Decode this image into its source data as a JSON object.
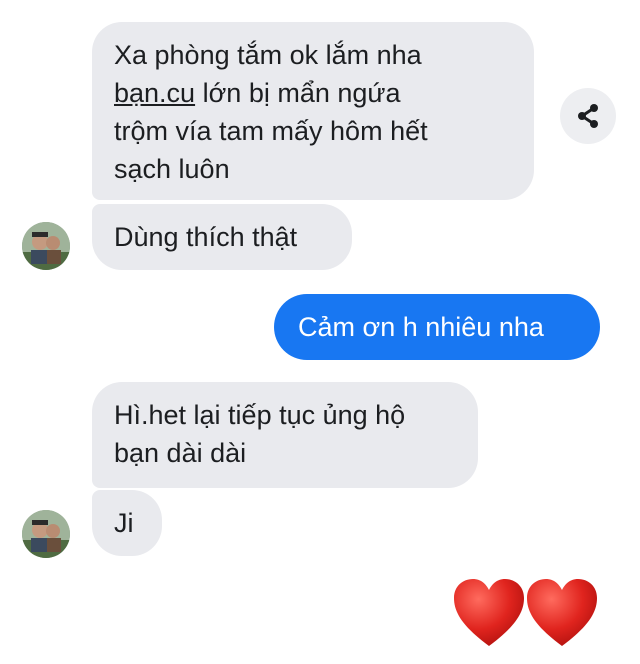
{
  "messages": [
    {
      "side": "incoming",
      "lines": [
        "Xa phòng tắm ok lắm nha",
        "bạn.cu",
        "lớn bị mẩn ngứa",
        "trộm vía tam mấy hôm hết",
        "sạch luôn"
      ]
    },
    {
      "side": "incoming",
      "text": "Dùng thích thật"
    },
    {
      "side": "outgoing",
      "text": "Cảm ơn h nhiêu nha"
    },
    {
      "side": "incoming",
      "lines": [
        "Hì.het lại tiếp tục ủng hộ",
        "bạn dài dài"
      ]
    },
    {
      "side": "incoming",
      "text": "Ji"
    }
  ],
  "reaction": {
    "icon": "heart-icon",
    "count_shown": 2,
    "color": "#e0241e"
  },
  "share_button": {
    "icon": "share-icon"
  },
  "colors": {
    "incoming_bubble": "#e9eaee",
    "outgoing_bubble": "#1877f2"
  }
}
